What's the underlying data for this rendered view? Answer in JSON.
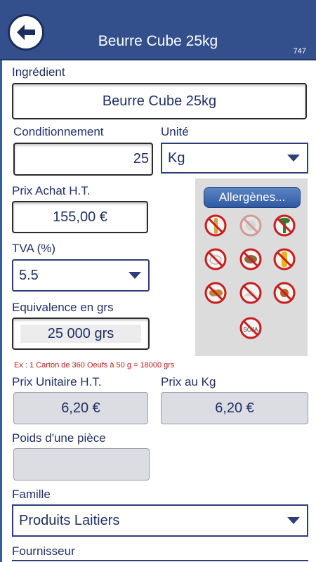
{
  "header": {
    "title": "Beurre Cube 25kg",
    "id": "747",
    "back_icon": "arrow-left-icon"
  },
  "ingredient": {
    "label": "Ingrédient",
    "value": "Beurre Cube 25kg"
  },
  "conditionnement": {
    "label": "Conditionnement",
    "value": "25"
  },
  "unite": {
    "label": "Unité",
    "value": "Kg"
  },
  "prix_achat": {
    "label": "Prix Achat H.T.",
    "value": "155,00 €"
  },
  "allergenes": {
    "button_label": "Allergènes...",
    "items": [
      {
        "name": "gluten-icon",
        "active": true
      },
      {
        "name": "crustacean-icon",
        "active": false
      },
      {
        "name": "celery-icon",
        "active": true
      },
      {
        "name": "egg-icon",
        "active": true
      },
      {
        "name": "fish-icon",
        "active": true
      },
      {
        "name": "mustard-icon",
        "active": true
      },
      {
        "name": "peanut-icon",
        "active": true
      },
      {
        "name": "sesame-icon",
        "active": true
      },
      {
        "name": "nut-icon",
        "active": true
      },
      {
        "name": "soy-icon",
        "active": true
      }
    ]
  },
  "tva": {
    "label": "TVA (%)",
    "value": "5.5"
  },
  "equivalence": {
    "label": "Equivalence en grs",
    "value": "25 000 grs"
  },
  "example_text": "Ex : 1 Carton de 360 Oeufs à 50 g = 18000 grs",
  "prix_unitaire": {
    "label": "Prix Unitaire H.T.",
    "value": "6,20 €"
  },
  "prix_kg": {
    "label": "Prix au Kg",
    "value": "6,20 €"
  },
  "poids_piece": {
    "label": "Poids d'une pièce",
    "value": ""
  },
  "famille": {
    "label": "Famille",
    "value": "Produits Laitiers"
  },
  "fournisseur": {
    "label": "Fournisseur"
  },
  "colors": {
    "header_bg": "#34508c",
    "label_text": "#1f3066",
    "example_text": "#c01818",
    "forbidden_red": "#c81e1e"
  }
}
